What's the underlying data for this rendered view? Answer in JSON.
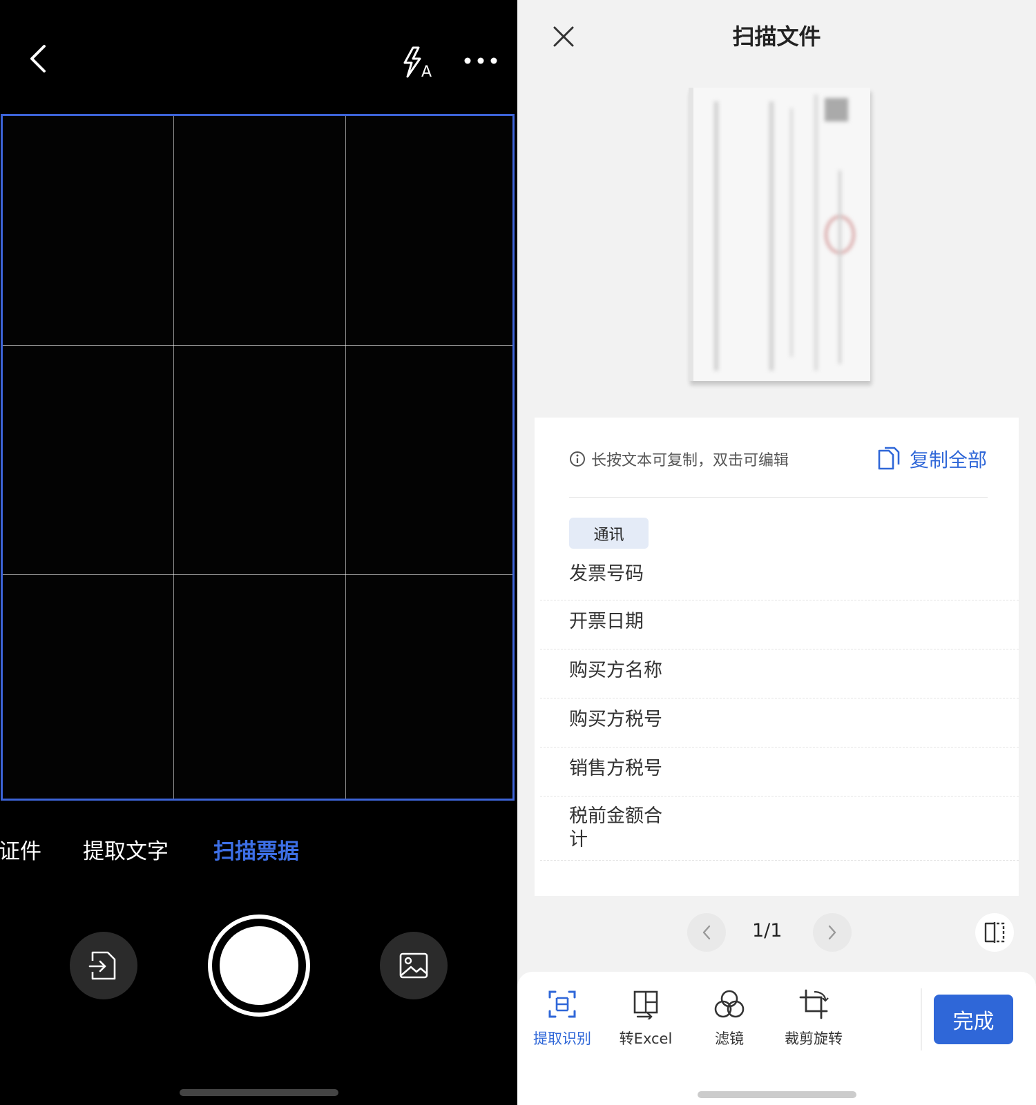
{
  "camera": {
    "modes": [
      "证件",
      "提取文字",
      "扫描票据"
    ],
    "active_mode": "扫描票据"
  },
  "result": {
    "title": "扫描文件",
    "hint": "长按文本可复制，双击可编辑",
    "copy_all": "复制全部",
    "category_tag": "通讯",
    "fields": [
      "发票号码",
      "开票日期",
      "购买方名称",
      "购买方税号",
      "销售方税号",
      "税前金额合\n计"
    ],
    "pager": "1/1",
    "tools": [
      {
        "label": "提取识别",
        "icon": "extract-icon",
        "active": true
      },
      {
        "label": "转Excel",
        "icon": "excel-icon",
        "active": false
      },
      {
        "label": "滤镜",
        "icon": "filter-icon",
        "active": false
      },
      {
        "label": "裁剪旋转",
        "icon": "crop-rotate-icon",
        "active": false
      }
    ],
    "done": "完成"
  },
  "colors": {
    "accent": "#2f67d8",
    "viewfinder_border": "#3d64d8"
  }
}
